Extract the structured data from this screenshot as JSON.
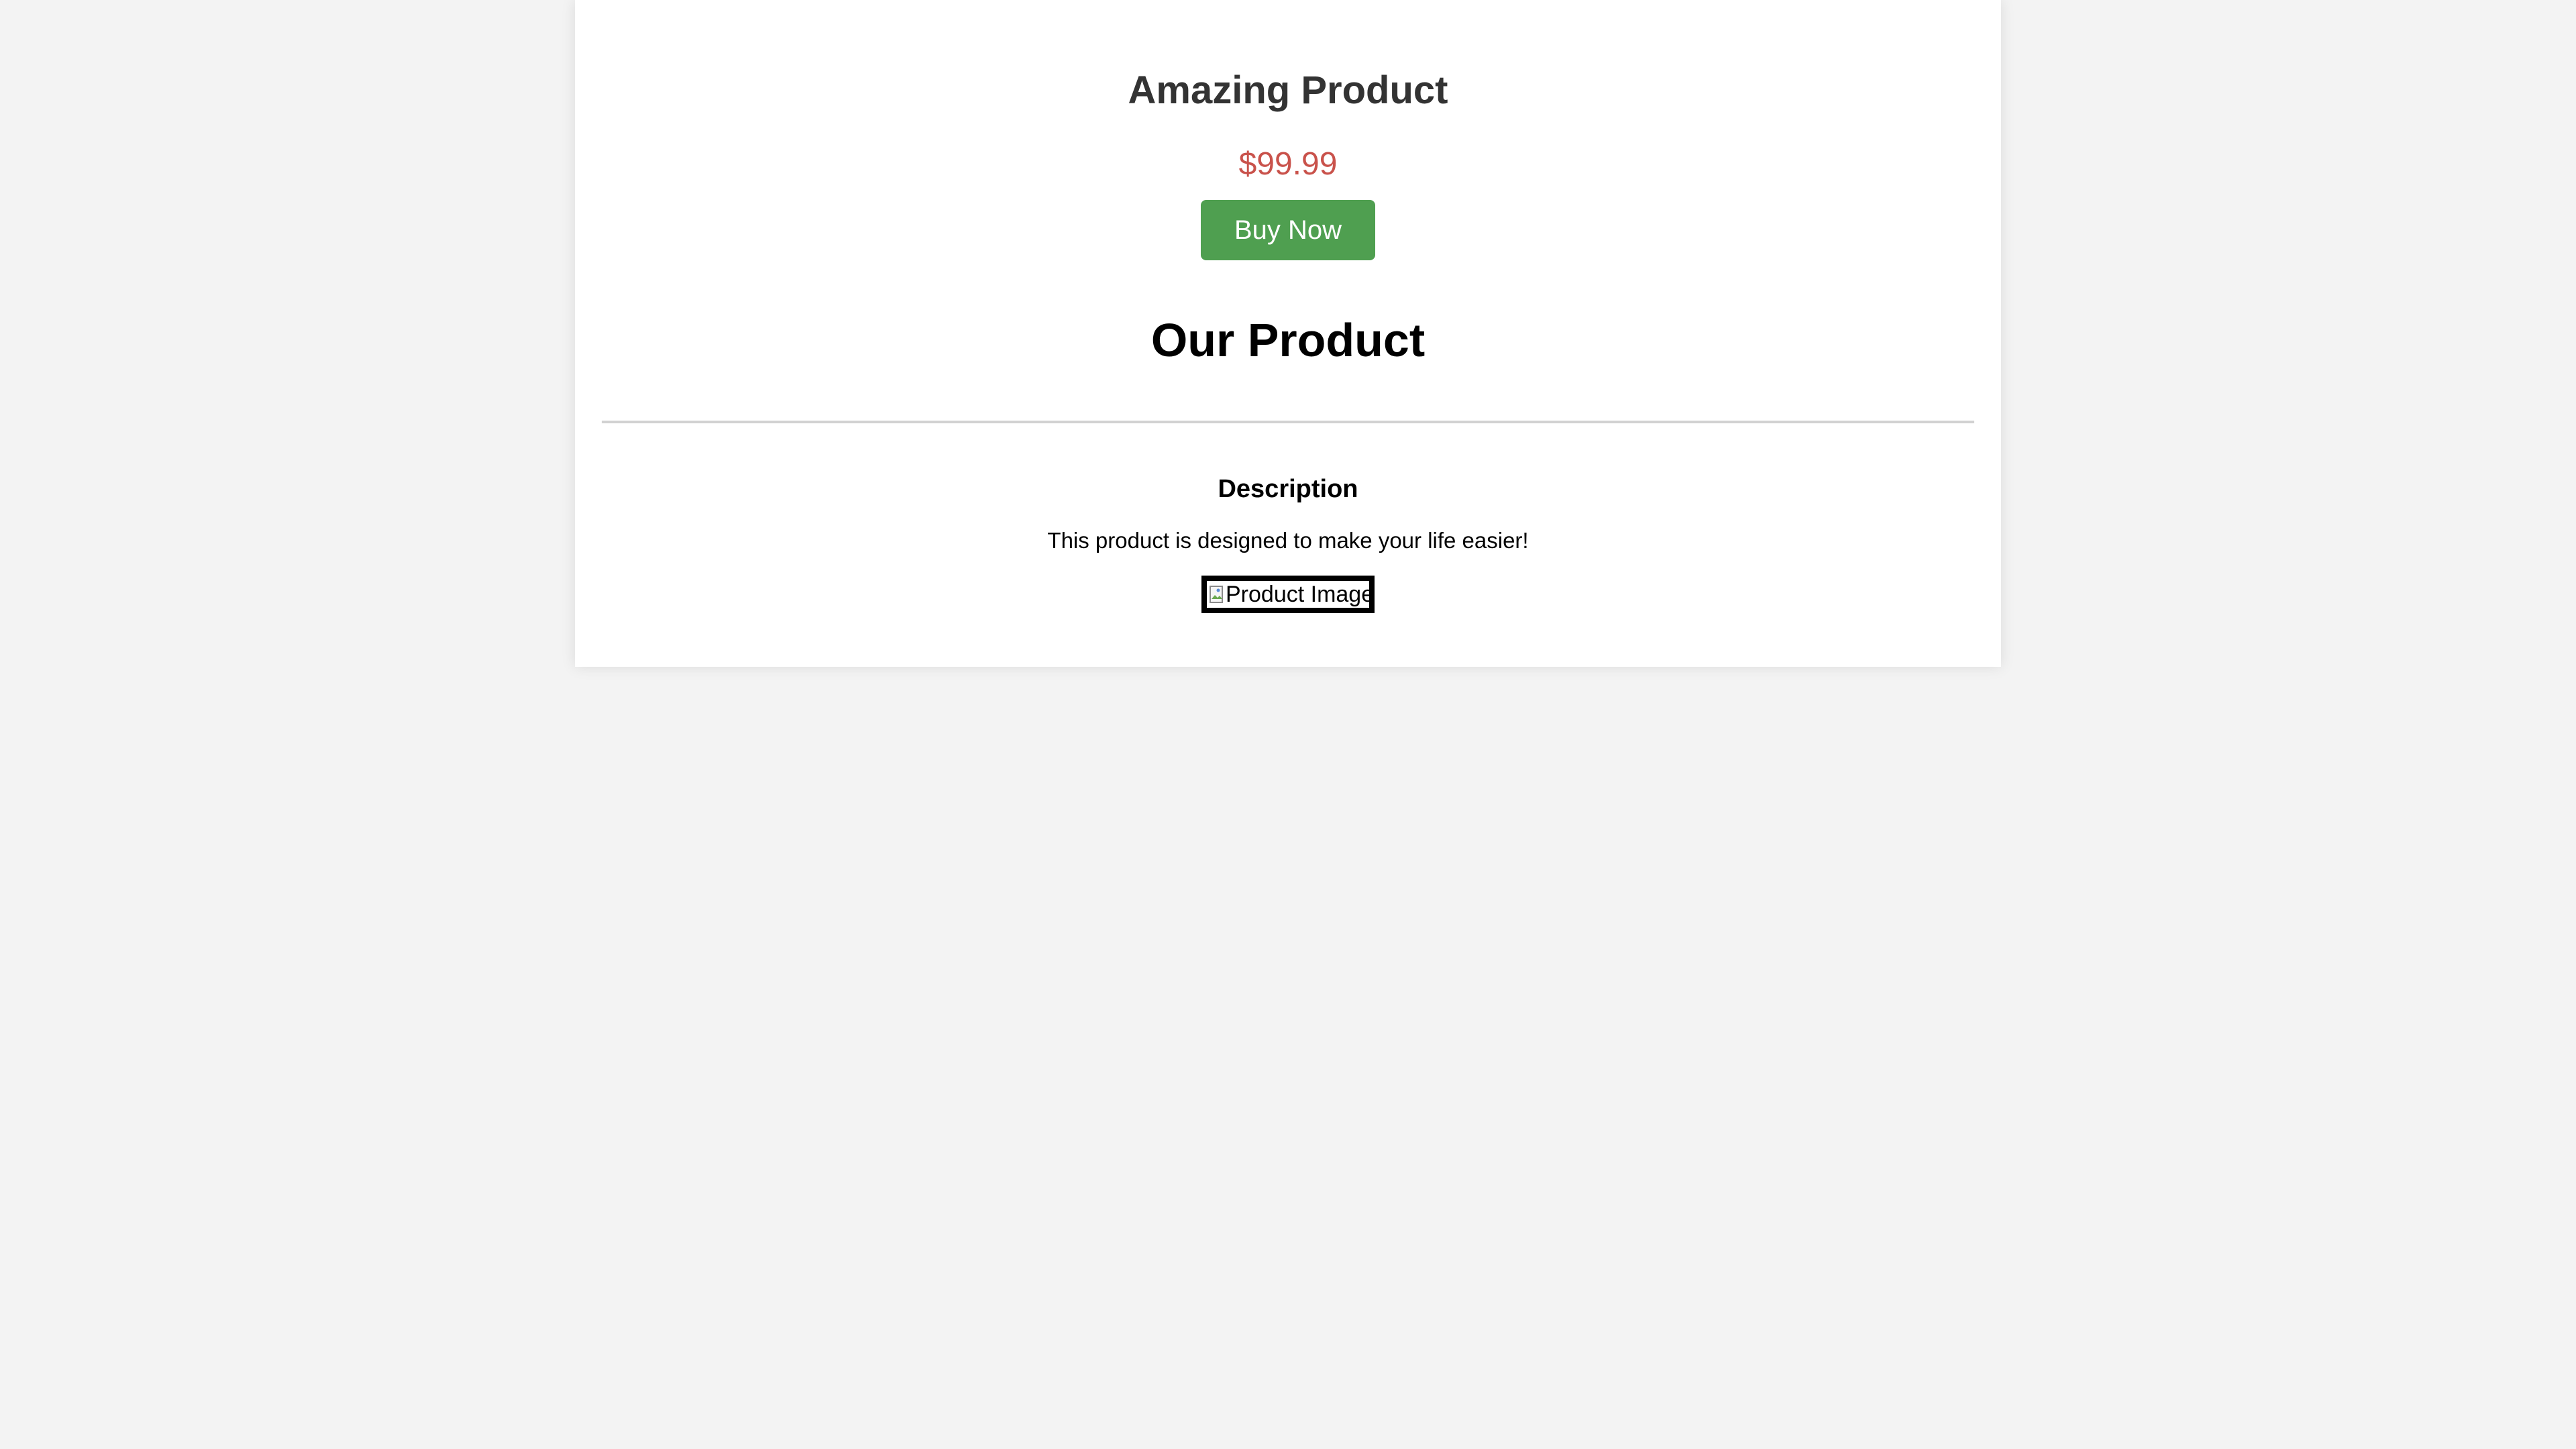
{
  "product": {
    "name": "Amazing Product",
    "price": "$99.99",
    "buy_label": "Buy Now"
  },
  "section": {
    "title": "Our Product",
    "description_heading": "Description",
    "description_text": "This product is designed to make your life easier!",
    "image_alt": "Product Image",
    "image_icon": "broken-image-icon"
  },
  "colors": {
    "background": "#f3f3f3",
    "card": "#ffffff",
    "title": "#333333",
    "price": "#c9524b",
    "buy_button": "#4f9f50",
    "divider": "#d2d2d2"
  }
}
